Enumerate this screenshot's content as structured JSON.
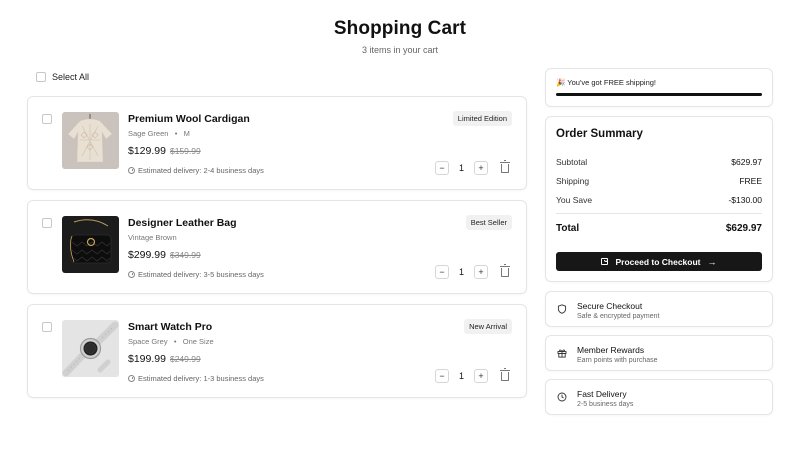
{
  "header": {
    "title": "Shopping Cart",
    "subtitle": "3 items in your cart"
  },
  "select_all_label": "Select All",
  "items": [
    {
      "name": "Premium Wool Cardigan",
      "variant": "Sage Green",
      "size": "M",
      "price": "$129.99",
      "original_price": "$159.99",
      "delivery": "Estimated delivery: 2-4 business days",
      "badge": "Limited Edition",
      "quantity": "1"
    },
    {
      "name": "Designer Leather Bag",
      "variant": "Vintage Brown",
      "size": "",
      "price": "$299.99",
      "original_price": "$349.99",
      "delivery": "Estimated delivery: 3-5 business days",
      "badge": "Best Seller",
      "quantity": "1"
    },
    {
      "name": "Smart Watch Pro",
      "variant": "Space Grey",
      "size": "One Size",
      "price": "$199.99",
      "original_price": "$249.99",
      "delivery": "Estimated delivery: 1-3 business days",
      "badge": "New Arrival",
      "quantity": "1"
    }
  ],
  "shipping": {
    "message": "🎉 You've got FREE shipping!",
    "progress": 1.0
  },
  "summary": {
    "title": "Order Summary",
    "subtotal_label": "Subtotal",
    "subtotal_value": "$629.97",
    "shipping_label": "Shipping",
    "shipping_value": "FREE",
    "save_label": "You Save",
    "save_value": "-$130.00",
    "total_label": "Total",
    "total_value": "$629.97",
    "checkout_label": "Proceed to Checkout"
  },
  "features": [
    {
      "title": "Secure Checkout",
      "subtitle": "Safe & encrypted payment",
      "icon": "shield-icon"
    },
    {
      "title": "Member Rewards",
      "subtitle": "Earn points with purchase",
      "icon": "gift-icon"
    },
    {
      "title": "Fast Delivery",
      "subtitle": "2-5 business days",
      "icon": "clock-icon"
    }
  ],
  "colors": {
    "primary": "#171717",
    "border": "#e5e5e5",
    "muted_text": "#777777",
    "badge_bg": "#f1f1f1"
  }
}
